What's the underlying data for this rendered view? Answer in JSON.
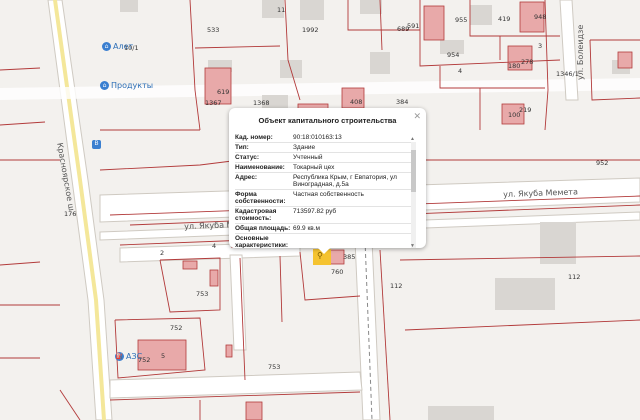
{
  "map": {
    "streets": {
      "krasnoyarskoe": "Красноярское ш",
      "yakuba_memeta_1": "ул. Якуба Мемета",
      "yakuba_memeta_2": "ул. Якуба Мемета",
      "bolelidze": "ул. Болеидзе"
    },
    "poi": {
      "alet": "Алет",
      "alet_num": "10/1",
      "produkty": "Продукты",
      "azs": "АЗС"
    },
    "parcel_labels": {
      "p533": "533",
      "p1992": "1992",
      "p11": "11",
      "p689": "689",
      "p591": "591",
      "p955": "955",
      "p419": "419",
      "p948": "948",
      "p954": "954",
      "p180": "180",
      "p278": "278",
      "p4": "4",
      "p3": "3",
      "p1346": "1346/1",
      "p1367": "1367",
      "p619": "619",
      "p1368": "1368",
      "p408": "408",
      "p384": "384",
      "p100": "100",
      "p219": "219",
      "p952": "952",
      "p176": "176",
      "p2": "2",
      "p753a": "753",
      "p4b": "4",
      "p760": "760",
      "p385": "385",
      "p112a": "112",
      "p112b": "112",
      "p752a": "752",
      "p752b": "752",
      "p753b": "753",
      "p5": "5"
    }
  },
  "popup": {
    "title": "Объект капитального строительства",
    "close_icon": "close-icon",
    "rows": [
      {
        "k": "Кад. номер:",
        "v": "90:18:010163:13"
      },
      {
        "k": "Тип:",
        "v": "Здание"
      },
      {
        "k": "Статус:",
        "v": "Учтенный"
      },
      {
        "k": "Наименование:",
        "v": "Токарный цех"
      },
      {
        "k": "Адрес:",
        "v": "Республика Крым, г Евпатория, ул Виноградная, д.5а"
      },
      {
        "k": "Форма собственности:",
        "v": "Частная собственность"
      },
      {
        "k": "Кадастровая стоимость:",
        "v": "713597.82 руб"
      },
      {
        "k": "Общая площадь:",
        "v": "69.9 кв.м"
      },
      {
        "k": "Основные характеристики:",
        "v": ""
      }
    ]
  },
  "colors": {
    "parcel_line": "#b23a3a",
    "building_fill": "#e8a9a9",
    "road_yellow": "#f4e79a",
    "marker": "#f5c330"
  }
}
